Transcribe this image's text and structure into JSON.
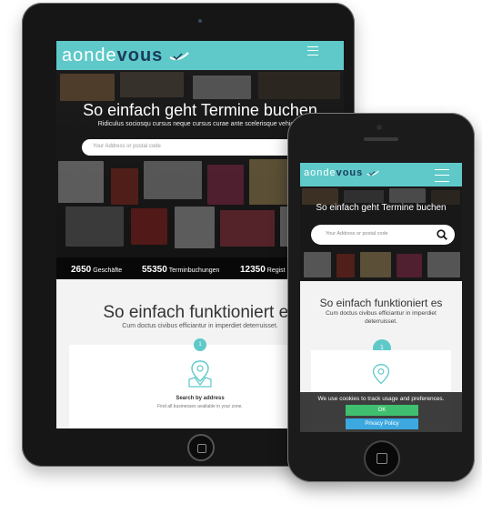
{
  "tablet": {
    "brand_left": "aonde",
    "brand_right": "vous",
    "hero_title": "So einfach geht Termine buchen",
    "hero_subtitle": "Ridiculus sociosqu cursus neque cursus curae ante scelerisque vehicula",
    "search_placeholder": "Your Address or postal code",
    "stats": [
      {
        "value": "2650",
        "label": "Geschäfte"
      },
      {
        "value": "55350",
        "label": "Terminbuchungen"
      },
      {
        "value": "12350",
        "label": "Regist"
      }
    ],
    "how_title": "So einfach funktioniert es",
    "how_subtitle": "Cum doctus civibus efficiantur in imperdiet deterruisset.",
    "step_number": "1",
    "step_title": "Search by address",
    "step_desc": "Find all businesses available in your zone."
  },
  "phone": {
    "brand_left": "aonde",
    "brand_right": "vous",
    "hero_title": "So einfach geht Termine buchen",
    "search_placeholder": "Your Address or postal code",
    "how_title": "So einfach funktioniert es",
    "how_subtitle": "Cum doctus civibus efficiantur in imperdiet deterruisset.",
    "step_number": "1",
    "cookie_text": "We use cookies to track usage and preferences.",
    "ok_label": "OK",
    "privacy_label": "Privacy Policy"
  },
  "colors": {
    "accent": "#5fc9c9",
    "navy": "#1a3b5c",
    "ok": "#3fbf6f",
    "privacy": "#3da8e0"
  }
}
